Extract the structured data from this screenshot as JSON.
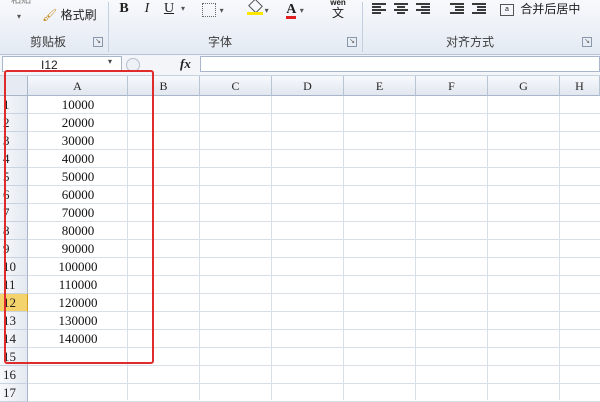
{
  "ribbon": {
    "paste_label": "粘贴",
    "format_painter_label": "格式刷",
    "bold": "B",
    "italic": "I",
    "underline": "U",
    "phonetic_top": "wén",
    "phonetic_char": "文",
    "merge_center_label": "合并后居中",
    "groups": {
      "clipboard": "剪贴板",
      "font": "字体",
      "alignment": "对齐方式"
    },
    "font_color": "#e02020",
    "fill_color": "#ffe600"
  },
  "formula_bar": {
    "name_box": "I12",
    "fx": "fx",
    "formula": ""
  },
  "sheet": {
    "columns": [
      "A",
      "B",
      "C",
      "D",
      "E",
      "F",
      "G",
      "H"
    ],
    "rows": [
      "1",
      "2",
      "3",
      "4",
      "5",
      "6",
      "7",
      "8",
      "9",
      "10",
      "11",
      "12",
      "13",
      "14",
      "15",
      "16",
      "17"
    ],
    "active_row": "12",
    "column_a_values": [
      "10000",
      "20000",
      "30000",
      "40000",
      "50000",
      "60000",
      "70000",
      "80000",
      "90000",
      "100000",
      "110000",
      "120000",
      "130000",
      "140000"
    ],
    "highlight_color": "#e02b2b",
    "active_header_color": "#f5d36c"
  }
}
